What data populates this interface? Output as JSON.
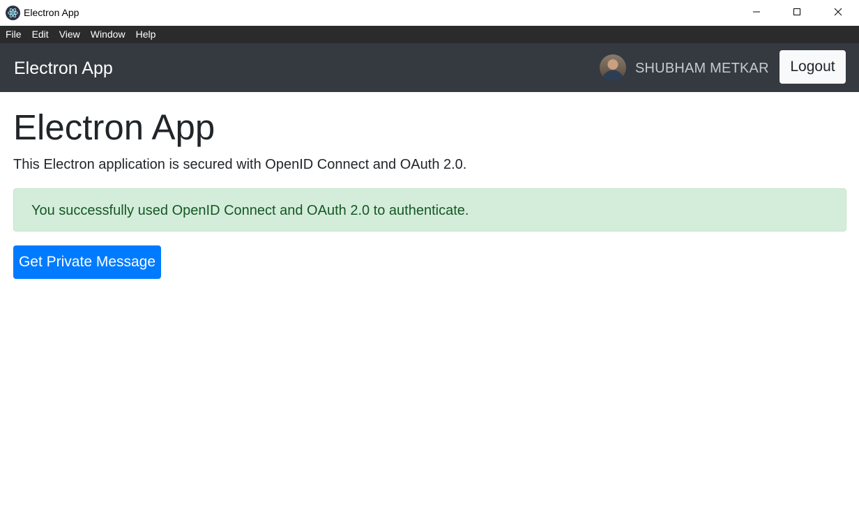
{
  "window": {
    "title": "Electron App",
    "app_icon": "electron-icon",
    "controls": [
      "minimize-icon",
      "maximize-icon",
      "close-icon"
    ]
  },
  "menubar": {
    "items": [
      "File",
      "Edit",
      "View",
      "Window",
      "Help"
    ]
  },
  "navbar": {
    "brand": "Electron App",
    "user_name": "SHUBHAM METKAR",
    "avatar": "user-avatar",
    "logout_label": "Logout"
  },
  "main": {
    "title": "Electron App",
    "lead": "This Electron application is secured with OpenID Connect and OAuth 2.0.",
    "alert": "You successfully used OpenID Connect and OAuth 2.0 to authenticate.",
    "button_label": "Get Private Message"
  },
  "colors": {
    "navbar_bg": "#343a40",
    "menubar_bg": "#2b2b2b",
    "alert_bg": "#d4edda",
    "alert_text": "#155724",
    "primary": "#007bff"
  }
}
